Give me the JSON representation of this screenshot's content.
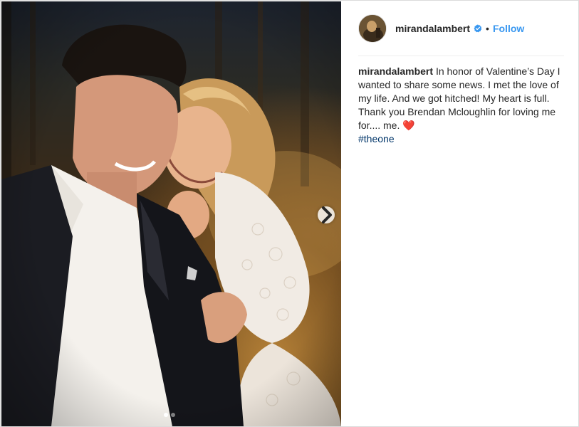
{
  "post": {
    "username": "mirandalambert",
    "follow_label": "Follow",
    "separator": "•",
    "caption_text": "In honor of Valentine’s Day I wanted to share some news. I met the love of my life. And we got hitched! My heart is full. Thank you Brendan Mcloughlin for loving me for.... me.",
    "heart_emoji": "❤️",
    "hashtag": "#theone"
  },
  "carousel": {
    "total_slides": 2,
    "current_slide": 1
  },
  "icons": {
    "verified": "verified-badge-icon",
    "next": "chevron-right-icon"
  },
  "colors": {
    "accent": "#3897f0",
    "hashtag": "#003569",
    "text": "#262626",
    "verified": "#3897f0"
  }
}
